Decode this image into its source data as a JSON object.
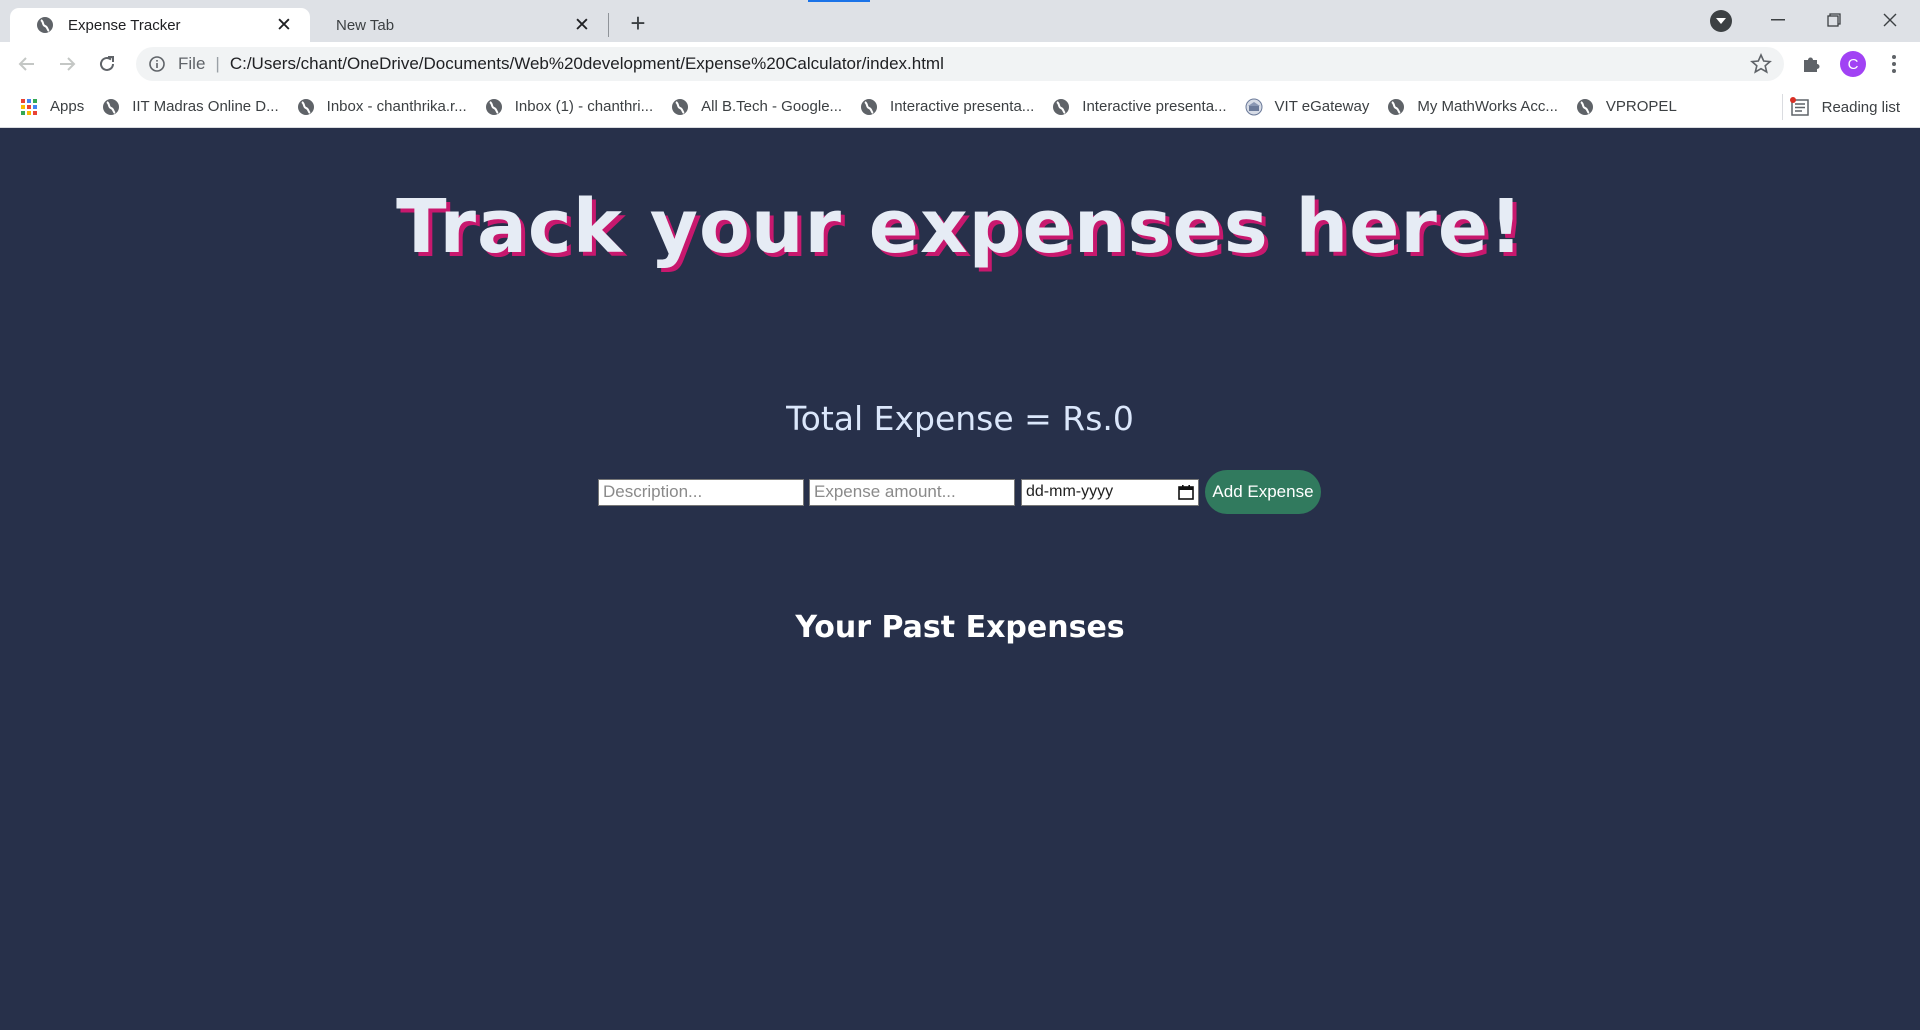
{
  "browser": {
    "tabs": [
      {
        "label": "Expense Tracker",
        "active": true
      },
      {
        "label": "New Tab",
        "active": false
      }
    ],
    "address": {
      "scheme": "File",
      "url": "C:/Users/chant/OneDrive/Documents/Web%20development/Expense%20Calculator/index.html"
    },
    "profile_initial": "C",
    "profile_color": "#a142f4",
    "bookmarks": [
      {
        "label": "Apps",
        "icon": "apps-grid-icon"
      },
      {
        "label": "IIT Madras Online D...",
        "icon": "globe-icon"
      },
      {
        "label": "Inbox - chanthrika.r...",
        "icon": "globe-icon"
      },
      {
        "label": "Inbox (1) - chanthri...",
        "icon": "globe-icon"
      },
      {
        "label": "All B.Tech - Google...",
        "icon": "globe-icon"
      },
      {
        "label": "Interactive presenta...",
        "icon": "globe-icon"
      },
      {
        "label": "Interactive presenta...",
        "icon": "globe-icon"
      },
      {
        "label": "VIT eGateway",
        "icon": "vit-logo-icon"
      },
      {
        "label": "My MathWorks Acc...",
        "icon": "globe-icon"
      },
      {
        "label": "VPROPEL",
        "icon": "globe-icon"
      }
    ],
    "reading_list": "Reading list"
  },
  "page": {
    "heading": "Track your expenses here!",
    "total_label": "Total Expense = Rs.",
    "total_value": "0",
    "form": {
      "description_placeholder": "Description...",
      "amount_placeholder": "Expense amount...",
      "date_placeholder": "dd-mm-yyyy",
      "add_button": "Add Expense"
    },
    "past_heading": "Your Past Expenses"
  },
  "colors": {
    "page_background": "#27304a",
    "heading_shadow": "#c8186e",
    "button_background": "#317a5e"
  }
}
